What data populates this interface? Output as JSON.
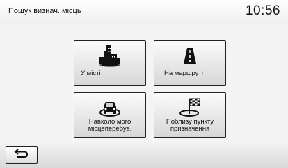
{
  "header": {
    "title": "Пошук визнач. місць",
    "clock": "10:56"
  },
  "options": [
    {
      "label": "У місті",
      "icon": "city-buildings-icon"
    },
    {
      "label": "На маршруті",
      "icon": "road-icon"
    },
    {
      "label": "Навколо мого місцеперебув.",
      "icon": "car-around-icon"
    },
    {
      "label": "Поблизу пункту призначення",
      "icon": "destination-flag-icon"
    }
  ],
  "footer": {
    "back_icon": "back-arrow-icon"
  }
}
